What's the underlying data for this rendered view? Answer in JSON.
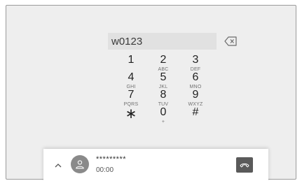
{
  "dial": {
    "entered_number": "w0123",
    "backspace_icon": "backspace-icon"
  },
  "keypad": {
    "keys": [
      {
        "digit": "1",
        "letters": ""
      },
      {
        "digit": "2",
        "letters": "ABC"
      },
      {
        "digit": "3",
        "letters": "DEF"
      },
      {
        "digit": "4",
        "letters": "GHI"
      },
      {
        "digit": "5",
        "letters": "JKL"
      },
      {
        "digit": "6",
        "letters": "MNO"
      },
      {
        "digit": "7",
        "letters": "PQRS"
      },
      {
        "digit": "8",
        "letters": "TUV"
      },
      {
        "digit": "9",
        "letters": "WXYZ"
      },
      {
        "digit": "∗",
        "letters": ""
      },
      {
        "digit": "0",
        "letters": "+"
      },
      {
        "digit": "#",
        "letters": ""
      }
    ]
  },
  "call": {
    "caller_name": "*********",
    "duration": "00:00",
    "expand_icon": "chevron-up-icon",
    "avatar_icon": "person-icon",
    "end_call_icon": "hang-up-icon"
  }
}
